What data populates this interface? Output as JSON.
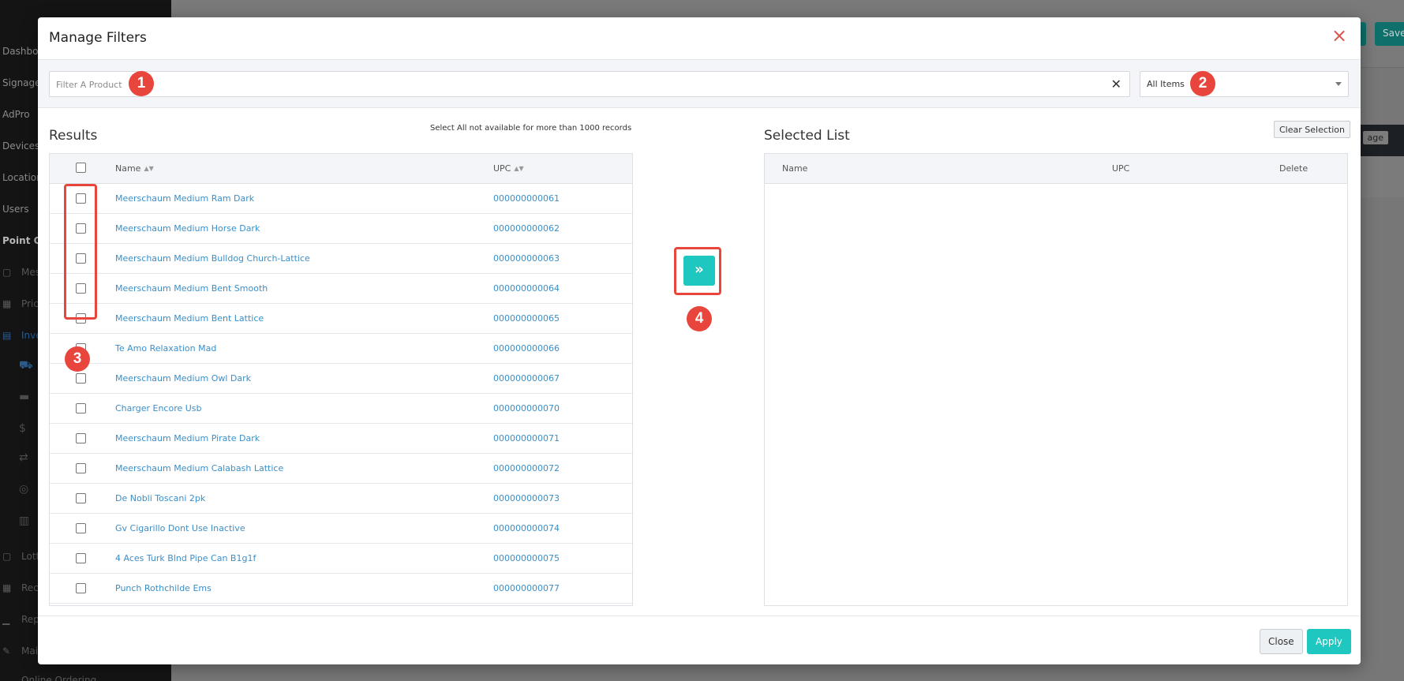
{
  "background": {
    "sidebar_items": [
      "Dashboa",
      "Signage",
      "AdPro",
      "Devices",
      "Location",
      "Users"
    ],
    "sidebar_section": "Point Of",
    "sidebar_sub_items": [
      "Mes",
      "Pric",
      "Inve",
      "Lott",
      "Rec",
      "Rep",
      "Mai",
      "Online Ordering"
    ],
    "top_buttons": [
      "e",
      "Save"
    ],
    "card_tag": "age"
  },
  "modal": {
    "title": "Manage Filters",
    "search": {
      "placeholder": "Filter A Product",
      "value": ""
    },
    "dropdown": {
      "selected": "All Items"
    },
    "results": {
      "title": "Results",
      "note": "Select All not available for more than 1000 records",
      "columns": {
        "name": "Name",
        "upc": "UPC"
      },
      "rows": [
        {
          "name": "Meerschaum Medium Ram Dark",
          "upc": "000000000061"
        },
        {
          "name": "Meerschaum Medium Horse Dark",
          "upc": "000000000062"
        },
        {
          "name": "Meerschaum Medium Bulldog Church-Lattice",
          "upc": "000000000063"
        },
        {
          "name": "Meerschaum Medium Bent Smooth",
          "upc": "000000000064"
        },
        {
          "name": "Meerschaum Medium Bent Lattice",
          "upc": "000000000065"
        },
        {
          "name": "Te Amo Relaxation Mad",
          "upc": "000000000066"
        },
        {
          "name": "Meerschaum Medium Owl Dark",
          "upc": "000000000067"
        },
        {
          "name": "Charger Encore Usb",
          "upc": "000000000070"
        },
        {
          "name": "Meerschaum Medium Pirate Dark",
          "upc": "000000000071"
        },
        {
          "name": "Meerschaum Medium Calabash Lattice",
          "upc": "000000000072"
        },
        {
          "name": "De Nobli Toscani 2pk",
          "upc": "000000000073"
        },
        {
          "name": "Gv Cigarillo Dont Use Inactive",
          "upc": "000000000074"
        },
        {
          "name": "4 Aces Turk Blnd Pipe Can B1g1f",
          "upc": "000000000075"
        },
        {
          "name": "Punch Rothchilde Ems",
          "upc": "000000000077"
        }
      ]
    },
    "move_button": "»",
    "selected": {
      "title": "Selected List",
      "clear_label": "Clear Selection",
      "columns": {
        "name": "Name",
        "upc": "UPC",
        "delete": "Delete"
      }
    },
    "footer": {
      "close_label": "Close",
      "apply_label": "Apply"
    }
  },
  "annotations": [
    "1",
    "2",
    "3",
    "4"
  ],
  "colors": {
    "accent": "#1ec7c0",
    "link": "#3a8fc9",
    "annotation": "#e8453c",
    "close": "#d9534f"
  }
}
